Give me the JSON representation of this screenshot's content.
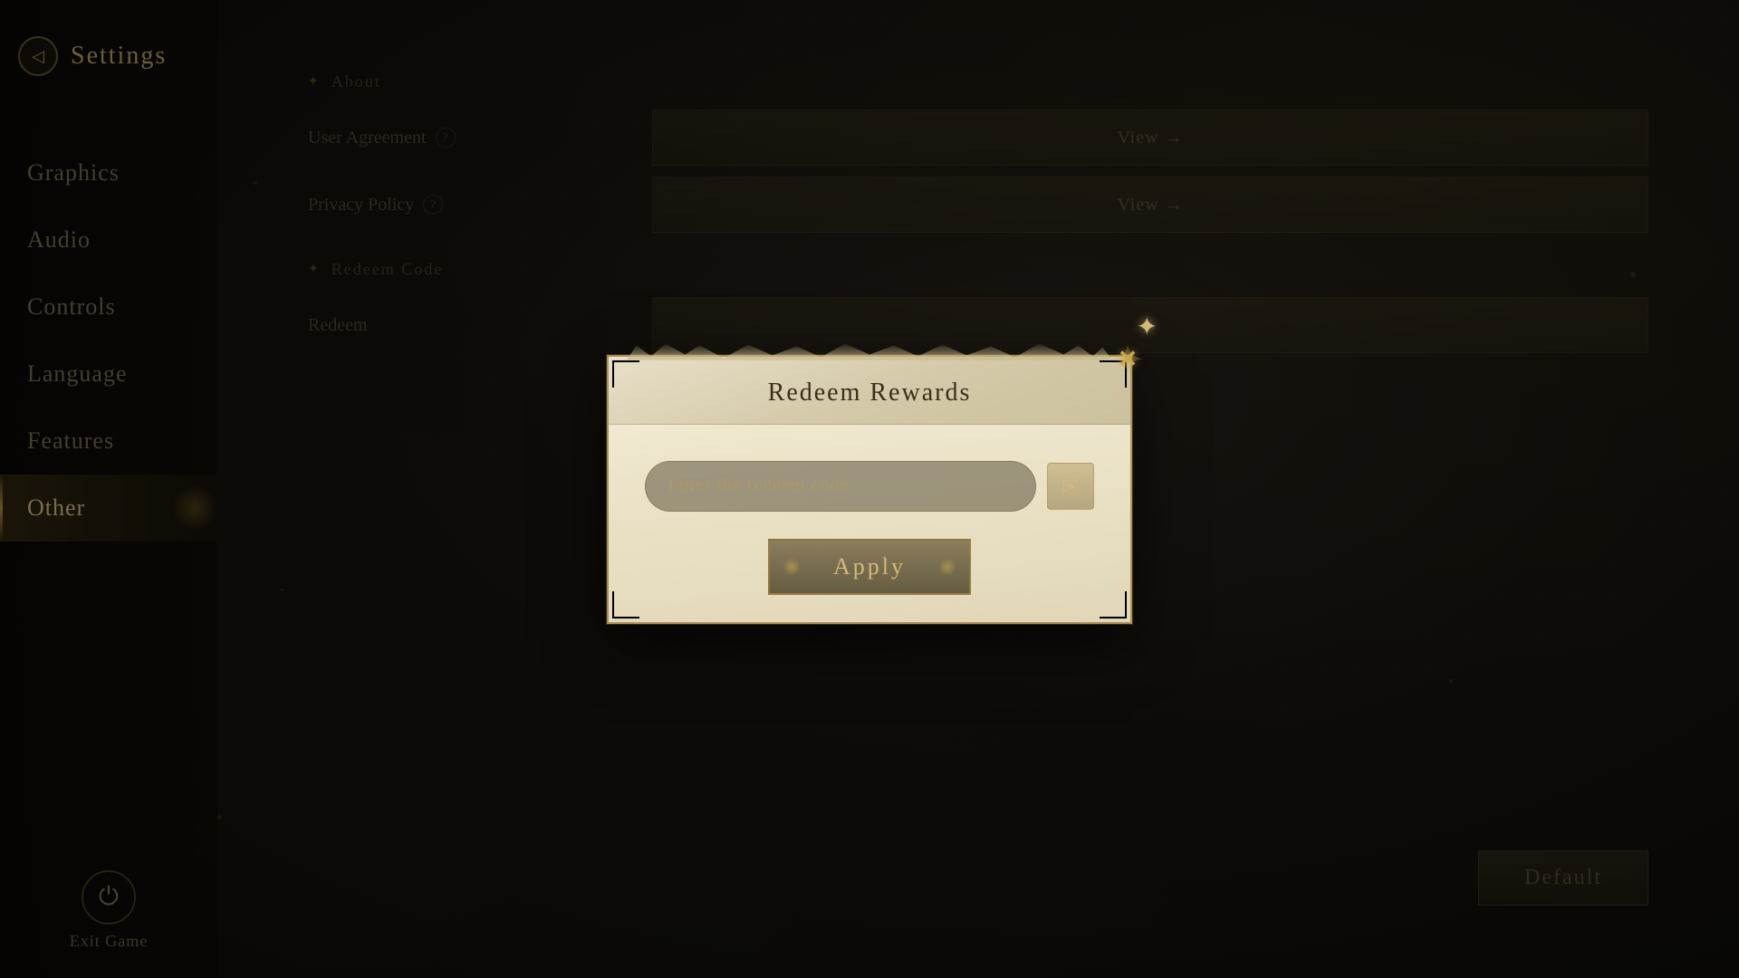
{
  "page": {
    "title": "Settings"
  },
  "sidebar": {
    "back_label": "←",
    "title": "Settings",
    "nav_items": [
      {
        "id": "graphics",
        "label": "Graphics",
        "active": false
      },
      {
        "id": "audio",
        "label": "Audio",
        "active": false
      },
      {
        "id": "controls",
        "label": "Controls",
        "active": false
      },
      {
        "id": "language",
        "label": "Language",
        "active": false
      },
      {
        "id": "features",
        "label": "Features",
        "active": false
      },
      {
        "id": "other",
        "label": "Other",
        "active": true
      }
    ],
    "exit_label": "Exit Game"
  },
  "main": {
    "about_section": "About",
    "user_agreement_label": "User Agreement",
    "user_agreement_help": "?",
    "user_agreement_btn": "View →",
    "privacy_policy_label": "Privacy Policy",
    "privacy_policy_help": "?",
    "privacy_policy_btn": "View →",
    "redeem_section": "Redeem Code",
    "redeem_label": "Redeem",
    "redeem_btn": "→",
    "default_btn": "Default"
  },
  "modal": {
    "title": "Redeem Rewards",
    "close_icon": "✕",
    "input_placeholder": "Enter the redeem code",
    "paste_icon": "📋",
    "apply_btn": "Apply"
  },
  "colors": {
    "accent": "#c8a84b",
    "text_primary": "#d4b87a",
    "text_muted": "#8a7a60",
    "bg_dark": "#0d0c0a"
  }
}
